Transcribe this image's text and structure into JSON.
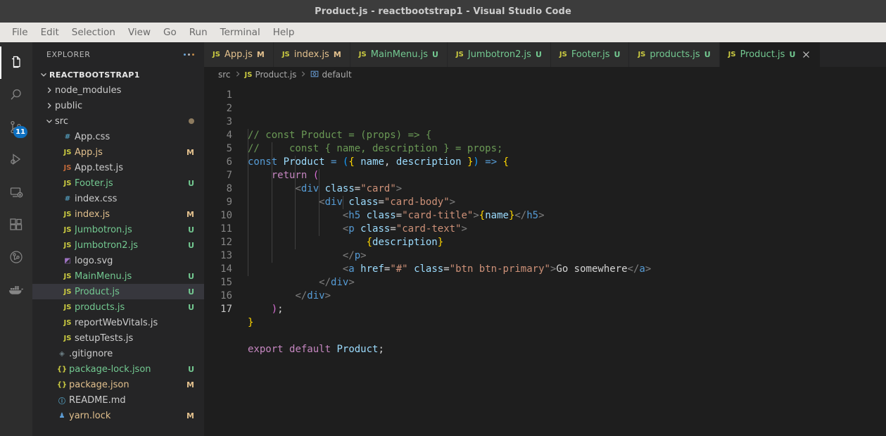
{
  "titlebar": {
    "title": "Product.js - reactbootstrap1 - Visual Studio Code"
  },
  "menubar": {
    "items": [
      "File",
      "Edit",
      "Selection",
      "View",
      "Go",
      "Run",
      "Terminal",
      "Help"
    ]
  },
  "activitybar": {
    "items": [
      {
        "name": "explorer",
        "icon": "files-icon",
        "active": true,
        "badge": ""
      },
      {
        "name": "search",
        "icon": "search-icon",
        "active": false,
        "badge": ""
      },
      {
        "name": "source-control",
        "icon": "source-control-icon",
        "active": false,
        "badge": "11"
      },
      {
        "name": "run-and-debug",
        "icon": "run-debug-icon",
        "active": false,
        "badge": ""
      },
      {
        "name": "remote-explorer",
        "icon": "remote-explorer-icon",
        "active": false,
        "badge": ""
      },
      {
        "name": "extensions",
        "icon": "extensions-icon",
        "active": false,
        "badge": ""
      },
      {
        "name": "git-graph",
        "icon": "git-graph-icon",
        "active": false,
        "badge": ""
      },
      {
        "name": "docker",
        "icon": "docker-whale-icon",
        "active": false,
        "badge": ""
      }
    ]
  },
  "sidebar": {
    "title": "EXPLORER",
    "actions_icon": "more-actions-icon",
    "root": {
      "label": "REACTBOOTSTRAP1",
      "expanded": true
    },
    "items": [
      {
        "label": "node_modules",
        "kind": "folder",
        "expanded": false,
        "indent": 1,
        "icon": "",
        "badge": "",
        "color": "default",
        "selected": false,
        "dot": false
      },
      {
        "label": "public",
        "kind": "folder",
        "expanded": false,
        "indent": 1,
        "icon": "",
        "badge": "",
        "color": "default",
        "selected": false,
        "dot": false
      },
      {
        "label": "src",
        "kind": "folder",
        "expanded": true,
        "indent": 1,
        "icon": "",
        "badge": "",
        "color": "default",
        "selected": false,
        "dot": true
      },
      {
        "label": "App.css",
        "kind": "file",
        "indent": 2,
        "icon": "css",
        "badge": "",
        "color": "default",
        "selected": false,
        "dot": false
      },
      {
        "label": "App.js",
        "kind": "file",
        "indent": 2,
        "icon": "js",
        "badge": "M",
        "color": "mod",
        "selected": false,
        "dot": false
      },
      {
        "label": "App.test.js",
        "kind": "file",
        "indent": 2,
        "icon": "jstest",
        "badge": "",
        "color": "default",
        "selected": false,
        "dot": false
      },
      {
        "label": "Footer.js",
        "kind": "file",
        "indent": 2,
        "icon": "js",
        "badge": "U",
        "color": "untracked",
        "selected": false,
        "dot": false
      },
      {
        "label": "index.css",
        "kind": "file",
        "indent": 2,
        "icon": "css",
        "badge": "",
        "color": "default",
        "selected": false,
        "dot": false
      },
      {
        "label": "index.js",
        "kind": "file",
        "indent": 2,
        "icon": "js",
        "badge": "M",
        "color": "mod",
        "selected": false,
        "dot": false
      },
      {
        "label": "Jumbotron.js",
        "kind": "file",
        "indent": 2,
        "icon": "js",
        "badge": "U",
        "color": "untracked",
        "selected": false,
        "dot": false
      },
      {
        "label": "Jumbotron2.js",
        "kind": "file",
        "indent": 2,
        "icon": "js",
        "badge": "U",
        "color": "untracked",
        "selected": false,
        "dot": false
      },
      {
        "label": "logo.svg",
        "kind": "file",
        "indent": 2,
        "icon": "svg",
        "badge": "",
        "color": "default",
        "selected": false,
        "dot": false
      },
      {
        "label": "MainMenu.js",
        "kind": "file",
        "indent": 2,
        "icon": "js",
        "badge": "U",
        "color": "untracked",
        "selected": false,
        "dot": false
      },
      {
        "label": "Product.js",
        "kind": "file",
        "indent": 2,
        "icon": "js",
        "badge": "U",
        "color": "untracked",
        "selected": true,
        "dot": false
      },
      {
        "label": "products.js",
        "kind": "file",
        "indent": 2,
        "icon": "js",
        "badge": "U",
        "color": "untracked",
        "selected": false,
        "dot": false
      },
      {
        "label": "reportWebVitals.js",
        "kind": "file",
        "indent": 2,
        "icon": "js",
        "badge": "",
        "color": "default",
        "selected": false,
        "dot": false
      },
      {
        "label": "setupTests.js",
        "kind": "file",
        "indent": 2,
        "icon": "js",
        "badge": "",
        "color": "default",
        "selected": false,
        "dot": false
      },
      {
        "label": ".gitignore",
        "kind": "file",
        "indent": 1,
        "icon": "git",
        "badge": "",
        "color": "default",
        "selected": false,
        "dot": false
      },
      {
        "label": "package-lock.json",
        "kind": "file",
        "indent": 1,
        "icon": "json",
        "badge": "U",
        "color": "untracked",
        "selected": false,
        "dot": false
      },
      {
        "label": "package.json",
        "kind": "file",
        "indent": 1,
        "icon": "json",
        "badge": "M",
        "color": "mod",
        "selected": false,
        "dot": false
      },
      {
        "label": "README.md",
        "kind": "file",
        "indent": 1,
        "icon": "md",
        "badge": "",
        "color": "default",
        "selected": false,
        "dot": false
      },
      {
        "label": "yarn.lock",
        "kind": "file",
        "indent": 1,
        "icon": "lock",
        "badge": "M",
        "color": "mod",
        "selected": false,
        "dot": false
      }
    ]
  },
  "tabs": [
    {
      "label": "App.js",
      "icon": "js",
      "badge": "M",
      "color": "mod",
      "active": false,
      "closable": false
    },
    {
      "label": "index.js",
      "icon": "js",
      "badge": "M",
      "color": "mod",
      "active": false,
      "closable": false
    },
    {
      "label": "MainMenu.js",
      "icon": "js",
      "badge": "U",
      "color": "untracked",
      "active": false,
      "closable": false
    },
    {
      "label": "Jumbotron2.js",
      "icon": "js",
      "badge": "U",
      "color": "untracked",
      "active": false,
      "closable": false
    },
    {
      "label": "Footer.js",
      "icon": "js",
      "badge": "U",
      "color": "untracked",
      "active": false,
      "closable": false
    },
    {
      "label": "products.js",
      "icon": "js",
      "badge": "U",
      "color": "untracked",
      "active": false,
      "closable": false
    },
    {
      "label": "Product.js",
      "icon": "js",
      "badge": "U",
      "color": "untracked",
      "active": true,
      "closable": true
    }
  ],
  "breadcrumbs": [
    {
      "label": "src",
      "icon": ""
    },
    {
      "label": "Product.js",
      "icon": "js"
    },
    {
      "label": "default",
      "icon": "symbol-object"
    }
  ],
  "editor": {
    "active_line": 17,
    "total_lines": 17,
    "lines": [
      {
        "n": 1,
        "tokens": [
          {
            "t": "// const Product = (props) => {",
            "c": "comment"
          }
        ]
      },
      {
        "n": 2,
        "tokens": [
          {
            "t": "//     const { name, description } = props;",
            "c": "comment"
          }
        ]
      },
      {
        "n": 3,
        "tokens": [
          {
            "t": "const",
            "c": "keyword"
          },
          {
            "t": " ",
            "c": "plain"
          },
          {
            "t": "Product",
            "c": "func"
          },
          {
            "t": " ",
            "c": "plain"
          },
          {
            "t": "=",
            "c": "op"
          },
          {
            "t": " ",
            "c": "plain"
          },
          {
            "t": "(",
            "c": "brace3"
          },
          {
            "t": "{",
            "c": "brace1"
          },
          {
            "t": " ",
            "c": "plain"
          },
          {
            "t": "name",
            "c": "param"
          },
          {
            "t": ",",
            "c": "plain"
          },
          {
            "t": " ",
            "c": "plain"
          },
          {
            "t": "description",
            "c": "param"
          },
          {
            "t": " ",
            "c": "plain"
          },
          {
            "t": "}",
            "c": "brace1"
          },
          {
            "t": ")",
            "c": "brace3"
          },
          {
            "t": " ",
            "c": "plain"
          },
          {
            "t": "=>",
            "c": "op"
          },
          {
            "t": " ",
            "c": "plain"
          },
          {
            "t": "{",
            "c": "brace1"
          }
        ]
      },
      {
        "n": 4,
        "tokens": [
          {
            "t": "    ",
            "c": "plain"
          },
          {
            "t": "return",
            "c": "ctrl"
          },
          {
            "t": " ",
            "c": "plain"
          },
          {
            "t": "(",
            "c": "brace2"
          }
        ]
      },
      {
        "n": 5,
        "tokens": [
          {
            "t": "        ",
            "c": "plain"
          },
          {
            "t": "<",
            "c": "tag"
          },
          {
            "t": "div",
            "c": "tagname"
          },
          {
            "t": " ",
            "c": "plain"
          },
          {
            "t": "class",
            "c": "attr"
          },
          {
            "t": "=",
            "c": "plain"
          },
          {
            "t": "\"card\"",
            "c": "string"
          },
          {
            "t": ">",
            "c": "tag"
          }
        ]
      },
      {
        "n": 6,
        "tokens": [
          {
            "t": "            ",
            "c": "plain"
          },
          {
            "t": "<",
            "c": "tag"
          },
          {
            "t": "div",
            "c": "tagname"
          },
          {
            "t": " ",
            "c": "plain"
          },
          {
            "t": "class",
            "c": "attr"
          },
          {
            "t": "=",
            "c": "plain"
          },
          {
            "t": "\"card-body\"",
            "c": "string"
          },
          {
            "t": ">",
            "c": "tag"
          }
        ]
      },
      {
        "n": 7,
        "tokens": [
          {
            "t": "                ",
            "c": "plain"
          },
          {
            "t": "<",
            "c": "tag"
          },
          {
            "t": "h5",
            "c": "tagname"
          },
          {
            "t": " ",
            "c": "plain"
          },
          {
            "t": "class",
            "c": "attr"
          },
          {
            "t": "=",
            "c": "plain"
          },
          {
            "t": "\"card-title\"",
            "c": "string"
          },
          {
            "t": ">",
            "c": "tag"
          },
          {
            "t": "{",
            "c": "brace1"
          },
          {
            "t": "name",
            "c": "var"
          },
          {
            "t": "}",
            "c": "brace1"
          },
          {
            "t": "</",
            "c": "tag"
          },
          {
            "t": "h5",
            "c": "tagname"
          },
          {
            "t": ">",
            "c": "tag"
          }
        ]
      },
      {
        "n": 8,
        "tokens": [
          {
            "t": "                ",
            "c": "plain"
          },
          {
            "t": "<",
            "c": "tag"
          },
          {
            "t": "p",
            "c": "tagname"
          },
          {
            "t": " ",
            "c": "plain"
          },
          {
            "t": "class",
            "c": "attr"
          },
          {
            "t": "=",
            "c": "plain"
          },
          {
            "t": "\"card-text\"",
            "c": "string"
          },
          {
            "t": ">",
            "c": "tag"
          }
        ]
      },
      {
        "n": 9,
        "tokens": [
          {
            "t": "                    ",
            "c": "plain"
          },
          {
            "t": "{",
            "c": "brace1"
          },
          {
            "t": "description",
            "c": "var"
          },
          {
            "t": "}",
            "c": "brace1"
          }
        ]
      },
      {
        "n": 10,
        "tokens": [
          {
            "t": "                ",
            "c": "plain"
          },
          {
            "t": "</",
            "c": "tag"
          },
          {
            "t": "p",
            "c": "tagname"
          },
          {
            "t": ">",
            "c": "tag"
          }
        ]
      },
      {
        "n": 11,
        "tokens": [
          {
            "t": "                ",
            "c": "plain"
          },
          {
            "t": "<",
            "c": "tag"
          },
          {
            "t": "a",
            "c": "tagname"
          },
          {
            "t": " ",
            "c": "plain"
          },
          {
            "t": "href",
            "c": "attr"
          },
          {
            "t": "=",
            "c": "plain"
          },
          {
            "t": "\"#\"",
            "c": "string"
          },
          {
            "t": " ",
            "c": "plain"
          },
          {
            "t": "class",
            "c": "attr"
          },
          {
            "t": "=",
            "c": "plain"
          },
          {
            "t": "\"btn btn-primary\"",
            "c": "string"
          },
          {
            "t": ">",
            "c": "tag"
          },
          {
            "t": "Go somewhere",
            "c": "text"
          },
          {
            "t": "</",
            "c": "tag"
          },
          {
            "t": "a",
            "c": "tagname"
          },
          {
            "t": ">",
            "c": "tag"
          }
        ]
      },
      {
        "n": 12,
        "tokens": [
          {
            "t": "            ",
            "c": "plain"
          },
          {
            "t": "</",
            "c": "tag"
          },
          {
            "t": "div",
            "c": "tagname"
          },
          {
            "t": ">",
            "c": "tag"
          }
        ]
      },
      {
        "n": 13,
        "tokens": [
          {
            "t": "        ",
            "c": "plain"
          },
          {
            "t": "</",
            "c": "tag"
          },
          {
            "t": "div",
            "c": "tagname"
          },
          {
            "t": ">",
            "c": "tag"
          }
        ]
      },
      {
        "n": 14,
        "tokens": [
          {
            "t": "    ",
            "c": "plain"
          },
          {
            "t": ")",
            "c": "brace2"
          },
          {
            "t": ";",
            "c": "plain"
          }
        ]
      },
      {
        "n": 15,
        "tokens": [
          {
            "t": "}",
            "c": "brace1"
          }
        ]
      },
      {
        "n": 16,
        "tokens": [
          {
            "t": "",
            "c": "plain"
          }
        ]
      },
      {
        "n": 17,
        "tokens": [
          {
            "t": "export",
            "c": "ctrl"
          },
          {
            "t": " ",
            "c": "plain"
          },
          {
            "t": "default",
            "c": "ctrl"
          },
          {
            "t": " ",
            "c": "plain"
          },
          {
            "t": "Product",
            "c": "func"
          },
          {
            "t": ";",
            "c": "plain"
          }
        ]
      }
    ],
    "indent_guides": [
      {
        "line_start": 4,
        "line_end": 14,
        "col": 0
      },
      {
        "line_start": 5,
        "line_end": 13,
        "col": 1
      },
      {
        "line_start": 6,
        "line_end": 12,
        "col": 2
      },
      {
        "line_start": 7,
        "line_end": 11,
        "col": 3
      },
      {
        "line_start": 9,
        "line_end": 9,
        "col": 4
      }
    ]
  },
  "colors": {
    "titlebar_bg": "#3c3c3c",
    "menubar_bg": "#e8e6e3",
    "activitybar_bg": "#2d2d2d",
    "sidebar_bg": "#252526",
    "editor_bg": "#1e1e1e",
    "tab_inactive_bg": "#2d2d2d",
    "tab_active_bg": "#1e1e1e",
    "selection_bg": "#37373d",
    "badge_bg": "#0e70c0",
    "modified_fg": "#e2c08d",
    "untracked_fg": "#73c991",
    "comment_fg": "#6a9955",
    "string_fg": "#ce9178",
    "keyword_fg": "#569cd6",
    "control_fg": "#c586c0",
    "variable_fg": "#9cdcfe"
  }
}
